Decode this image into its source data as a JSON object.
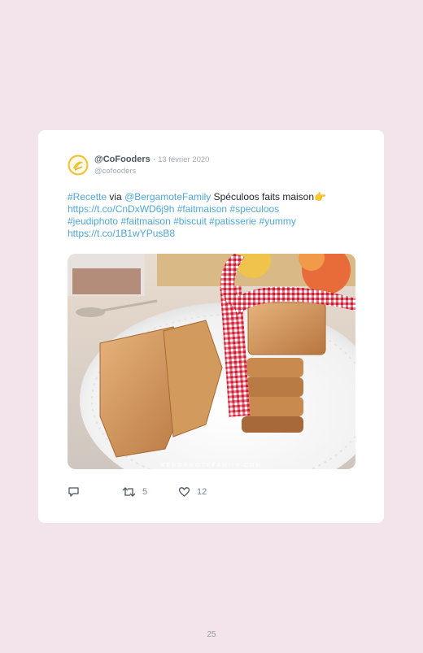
{
  "tweet": {
    "display_name": "@CoFooders",
    "separator": "·",
    "date": "13 février 2020",
    "handle": "@cofooders",
    "text": {
      "hashtag_recette": "#Recette",
      "via": "via",
      "mention": "@BergamoteFamily",
      "title": "Spéculoos faits maison",
      "emoji": "👉",
      "link1": "https://t.co/CnDxWD6j9h",
      "hashtag_faitmaison": "#faitmaison",
      "hashtag_speculoos": "#speculoos",
      "hashtag_jeudiphoto": "#jeudiphoto",
      "hashtag_faitmaison2": "#faitmaison",
      "hashtag_biscuit": "#biscuit",
      "hashtag_patisserie": "#patisserie",
      "hashtag_yummy": "#yummy",
      "link2": "https://t.co/1B1wYPusB8"
    },
    "photo_watermark": "BERGAMOTEFAMILY.COM",
    "actions": {
      "reply_icon": "reply-icon",
      "retweet_icon": "retweet-icon",
      "retweet_count": "5",
      "like_icon": "heart-icon",
      "like_count": "12"
    },
    "colors": {
      "link": "#4fa7dd",
      "name": "#4a5561",
      "muted": "#a0a9b2",
      "logo": "#f2c12e"
    }
  },
  "page": {
    "number": "25",
    "background": "#f2e4ea"
  }
}
